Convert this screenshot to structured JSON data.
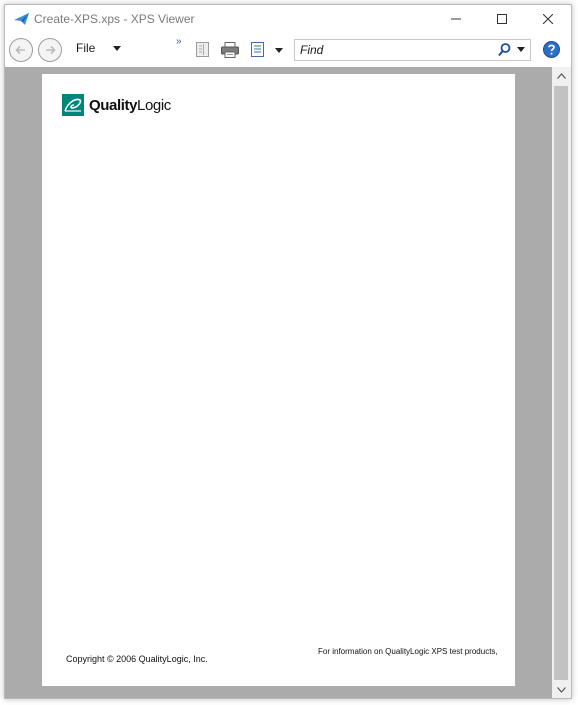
{
  "window": {
    "title": "Create-XPS.xps - XPS Viewer"
  },
  "toolbar": {
    "file_label": "File",
    "overflow_label": "»",
    "find_placeholder": "Find"
  },
  "document": {
    "logo": {
      "bold": "Quality",
      "light": "Logic"
    },
    "copyright": "Copyright © 2006 QualityLogic, Inc.",
    "info": "For information on QualityLogic XPS test products,"
  },
  "colors": {
    "accent": "#1a6fc9",
    "logo_teal": "#00857a",
    "doc_background": "#ababab",
    "help": "#2d6fc4"
  },
  "icons": {
    "app": "xps-viewer-icon",
    "back": "back-arrow-icon",
    "forward": "forward-arrow-icon",
    "page_layout": "page-layout-icon",
    "print": "print-icon",
    "view": "view-icon",
    "search": "search-icon",
    "help": "help-icon"
  }
}
